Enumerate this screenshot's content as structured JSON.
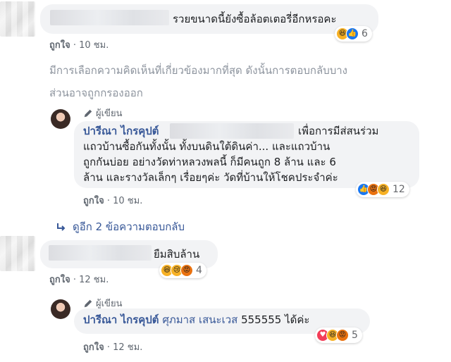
{
  "comment1": {
    "text": "รวยขนาดนี้ยังซื้อล้อตเตอรี่อีกหรอคะ",
    "reaction_count": "6",
    "like_label": "ถูกใจ",
    "time": "10 ชม."
  },
  "filter_notice": {
    "line1": "มีการเลือกความคิดเห็นที่เกี่ยวข้องมากที่สุด ดังนั้นการตอบกลับบาง",
    "line2": "ส่วนอาจถูกกรองออก"
  },
  "reply1": {
    "badge": "ผู้เขียน",
    "author": "ปารีณา ไกรคุปต์",
    "line1_tail": "เพื่อการมีส่สนร่วม",
    "line2": "แถวบ้านซื้อกันทั้งนั้น ทั้งบนดินใต้ดินค่า... และแถวบ้าน",
    "line3": "ถูกกันบ่อย อย่างวัดท่าหลวงพลนี้ ก็มีคนถูก 8 ล้าน และ 6",
    "line4": "ล้าน และรางวัลเล็กๆ เรื่อยๆค่ะ วัดที่บ้านให้โชคประจำค่ะ",
    "reaction_count": "12",
    "like_label": "ถูกใจ",
    "time": "10 ชม."
  },
  "more_replies": "ดูอีก 2 ข้อความตอบกลับ",
  "comment2": {
    "text": "ยืมสิบล้าน",
    "reaction_count": "4",
    "like_label": "ถูกใจ",
    "time": "12 ชม."
  },
  "reply2": {
    "badge": "ผู้เขียน",
    "author": "ปารีณา ไกรคุปต์",
    "mention": "ศุภมาส เสนะเวส",
    "text": "555555 ได้ค่ะ",
    "reaction_count": "5",
    "like_label": "ถูกใจ",
    "time": "12 ชม."
  },
  "colors": {
    "link": "#385898",
    "bubble": "#f2f3f5",
    "meta": "#606770",
    "notice": "#8d949e"
  }
}
